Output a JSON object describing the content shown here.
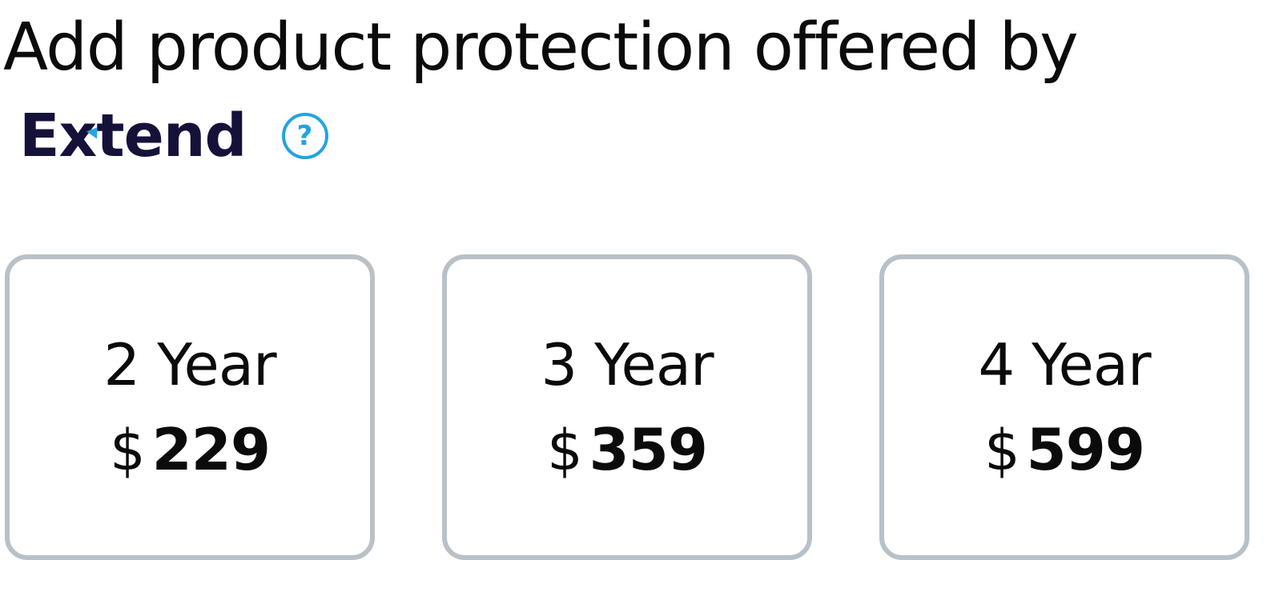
{
  "headline": "Add product protection offered by",
  "brand": {
    "name": "Extend",
    "help_icon": "question-circle-icon",
    "accent_color": "#26A6E0",
    "text_color": "#15123A"
  },
  "plans": [
    {
      "term": "2 Year",
      "currency": "$",
      "amount": "229"
    },
    {
      "term": "3 Year",
      "currency": "$",
      "amount": "359"
    },
    {
      "term": "4 Year",
      "currency": "$",
      "amount": "599"
    }
  ],
  "colors": {
    "card_border": "#B9C1C8",
    "help_icon": "#24A3DE"
  }
}
